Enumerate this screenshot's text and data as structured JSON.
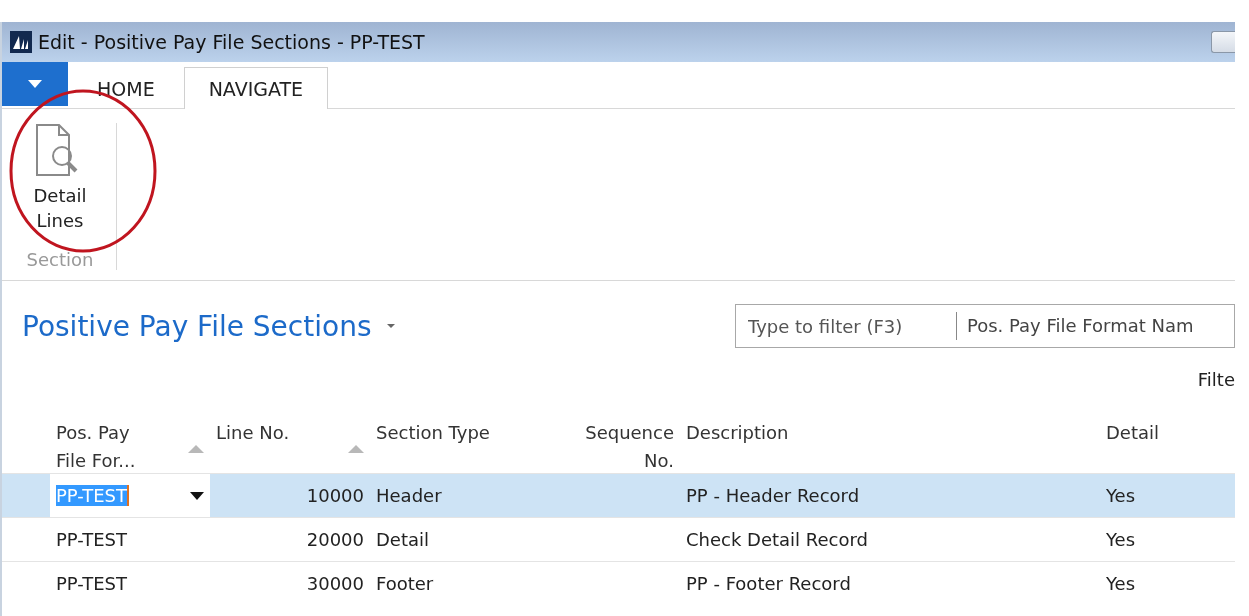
{
  "window": {
    "title": "Edit - Positive Pay File Sections - PP-TEST"
  },
  "ribbon": {
    "tabs": [
      {
        "label": "HOME",
        "selected": false
      },
      {
        "label": "NAVIGATE",
        "selected": true
      }
    ],
    "groups": [
      {
        "label": "Section",
        "actions": [
          {
            "label": "Detail Lines"
          }
        ]
      }
    ]
  },
  "page": {
    "title": "Positive Pay File Sections",
    "filter": {
      "placeholder": "Type to filter (F3)",
      "field": "Pos. Pay File Format Nam"
    },
    "filter_label": "Filte"
  },
  "table": {
    "columns": [
      {
        "label": "Pos. Pay File For...",
        "sorted": true
      },
      {
        "label": "Line No.",
        "sorted": true
      },
      {
        "label": "Section Type",
        "sorted": false
      },
      {
        "label": "Sequence No.",
        "sorted": false
      },
      {
        "label": "Description",
        "sorted": false
      },
      {
        "label": "Detail",
        "sorted": false
      }
    ],
    "rows": [
      {
        "cells": [
          "PP-TEST",
          "10000",
          "Header",
          "",
          "PP - Header Record",
          "Yes"
        ],
        "selected": true
      },
      {
        "cells": [
          "PP-TEST",
          "20000",
          "Detail",
          "",
          "Check Detail Record",
          "Yes"
        ],
        "selected": false
      },
      {
        "cells": [
          "PP-TEST",
          "30000",
          "Footer",
          "",
          "PP - Footer Record",
          "Yes"
        ],
        "selected": false
      }
    ]
  }
}
